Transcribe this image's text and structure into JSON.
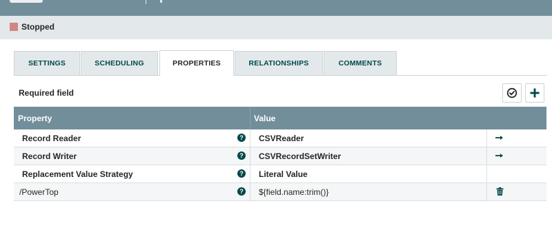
{
  "status": {
    "label": "Stopped",
    "color": "#d18686"
  },
  "tabs": [
    {
      "label": "SETTINGS",
      "active": false
    },
    {
      "label": "SCHEDULING",
      "active": false
    },
    {
      "label": "PROPERTIES",
      "active": true
    },
    {
      "label": "RELATIONSHIPS",
      "active": false
    },
    {
      "label": "COMMENTS",
      "active": false
    }
  ],
  "properties": {
    "required_label": "Required field",
    "columns": {
      "property": "Property",
      "value": "Value"
    },
    "rows": [
      {
        "name": "Record Reader",
        "value": "CSVReader",
        "required": true,
        "action_icon": "arrow-right-icon"
      },
      {
        "name": "Record Writer",
        "value": "CSVRecordSetWriter",
        "required": true,
        "action_icon": "arrow-right-icon"
      },
      {
        "name": "Replacement Value Strategy",
        "value": "Literal Value",
        "required": true,
        "action_icon": ""
      },
      {
        "name": "/PowerTop",
        "value": "${field.name:trim()}",
        "required": false,
        "action_icon": "trash-icon"
      }
    ]
  },
  "toolbar": {
    "verify_icon": "verify-check-icon",
    "add_icon": "add-property-icon"
  },
  "colors": {
    "header": "#728e9b",
    "accent": "#004849",
    "status_bar": "#e3e8eb"
  }
}
